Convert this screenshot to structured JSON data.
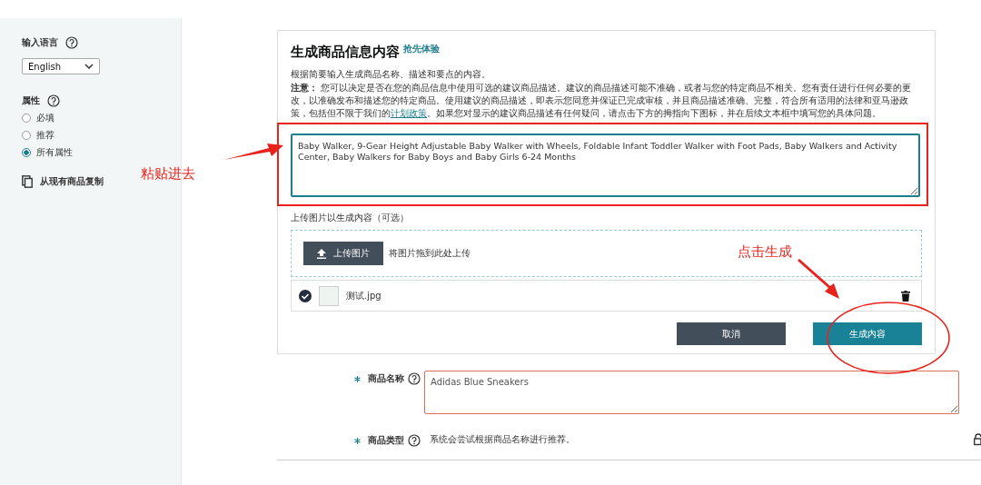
{
  "sidebar": {
    "language": {
      "label": "输入语言",
      "value": "English"
    },
    "attributes": {
      "label": "属性",
      "options": [
        {
          "label": "必填",
          "selected": false
        },
        {
          "label": "推荐",
          "selected": false
        },
        {
          "label": "所有属性",
          "selected": true
        }
      ]
    },
    "copy_link": "从现有商品复制"
  },
  "panel": {
    "title": "生成商品信息内容",
    "badge": "抢先体验",
    "intro": "根据简要输入生成商品名称、描述和要点的内容。",
    "notice": {
      "label": "注意：",
      "before": "您可以决定是否在您的商品信息中使用可选的建议商品描述。建议的商品描述可能不准确，或者与您的特定商品不相关。您有责任进行任何必要的更改，以准确发布和描述您的特定商品。使用建议的商品描述，即表示您同意并保证已完成审核，并且商品描述准确、完整，符合所有适用的法律和亚马逊政策，包括但不限于我们的",
      "link": "计划政策",
      "after": "。如果您对显示的建议商品描述有任何疑问，请点击下方的拇指向下图标，并在后续文本框中填写您的具体问题。"
    },
    "input_value": "Baby Walker, 9-Gear Height Adjustable Baby Walker with Wheels, Foldable Infant Toddler Walker with Foot Pads, Baby Walkers and Activity Center, Baby Walkers for Baby Boys and Baby Girls 6-24 Months",
    "upload_label": "上传图片以生成内容（可选）",
    "upload_button": "上传图片",
    "drop_hint": "将图片拖到此处上传",
    "files": [
      {
        "name": "测试.jpg",
        "checked": true
      }
    ],
    "buttons": [
      {
        "label": "取消",
        "kind": "secondary"
      },
      {
        "label": "生成内容",
        "kind": "primary"
      }
    ]
  },
  "form": {
    "fields": [
      {
        "label": "商品名称",
        "required": true,
        "kind": "textarea",
        "value": "Adidas Blue Sneakers"
      },
      {
        "label": "商品类型",
        "required": true,
        "kind": "text",
        "text": "系统会尝试根据商品名称进行推荐。"
      }
    ]
  },
  "annotations": [
    {
      "text": "粘贴进去",
      "kind": "paste"
    },
    {
      "text": "点击生成",
      "kind": "click"
    }
  ]
}
